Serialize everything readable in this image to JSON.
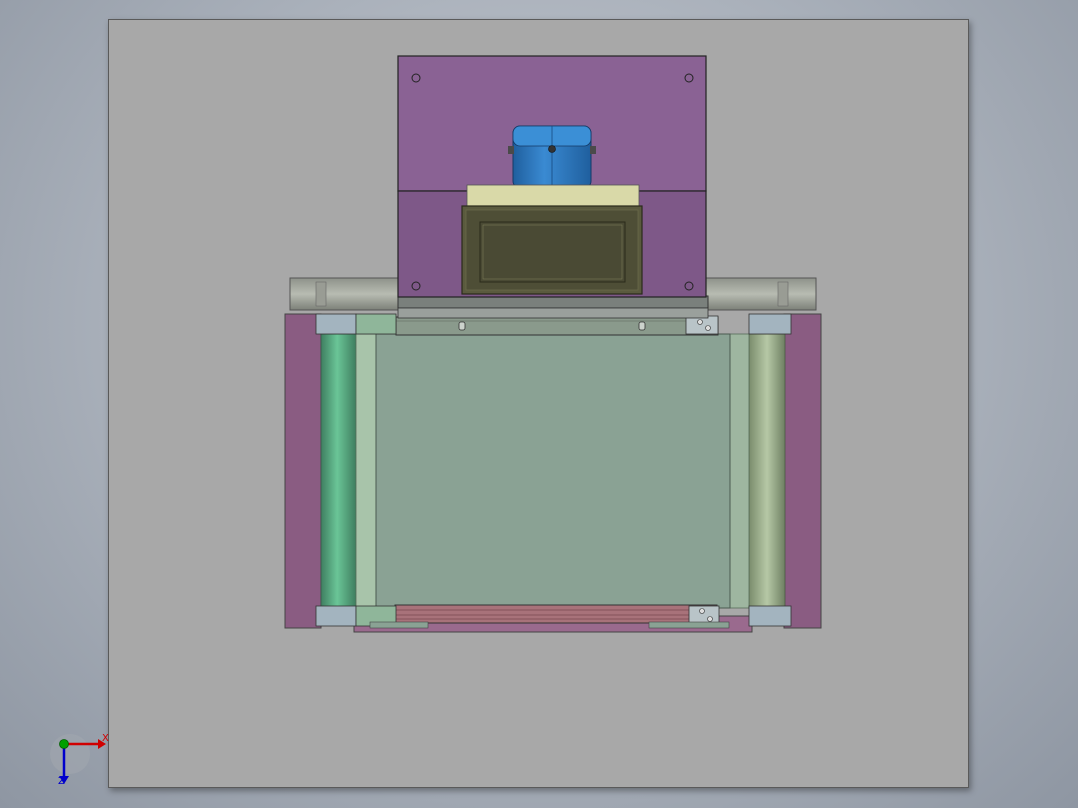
{
  "view": {
    "colors": {
      "background": "#a8a8a8",
      "upper_housing": "#8a6294",
      "lower_housing": "#7e5888",
      "motor": "#2f7ec4",
      "display_panel": "#4e4e36",
      "display_bezel": "#d9d9a8",
      "conveyor_bed": "#8aa294",
      "roller_left": "#5ea883",
      "roller_right": "#a2b692",
      "side_frame": "#8a5c82",
      "rail": "#8a8f86",
      "bracket": "#a3b4bf"
    }
  },
  "triad": {
    "x_label": "X",
    "z_label": "Z"
  }
}
